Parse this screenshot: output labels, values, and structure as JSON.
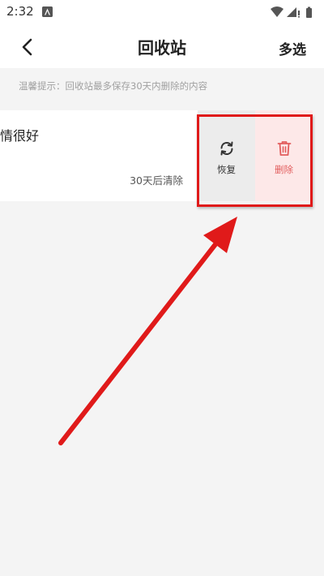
{
  "status_bar": {
    "time": "2:32",
    "notification_icon": "a-badge-icon",
    "right_icons": [
      "wifi-icon",
      "signal-icon",
      "battery-icon"
    ]
  },
  "app_bar": {
    "title": "回收站",
    "back_icon": "chevron-left-icon",
    "multi_select_label": "多选"
  },
  "tip": "温馨提示：回收站最多保存30天内删除的内容",
  "items": [
    {
      "title": "情很好",
      "expire_text": "30天后清除",
      "actions": [
        {
          "label": "恢复",
          "icon": "refresh-icon",
          "color": "#333333",
          "background": "#ececec"
        },
        {
          "label": "删除",
          "icon": "trash-icon",
          "color": "#e25c5c",
          "background": "#fde8e8"
        }
      ]
    }
  ],
  "annotations": {
    "highlight_color": "#e01a1a",
    "arrow_color": "#e01a1a"
  }
}
